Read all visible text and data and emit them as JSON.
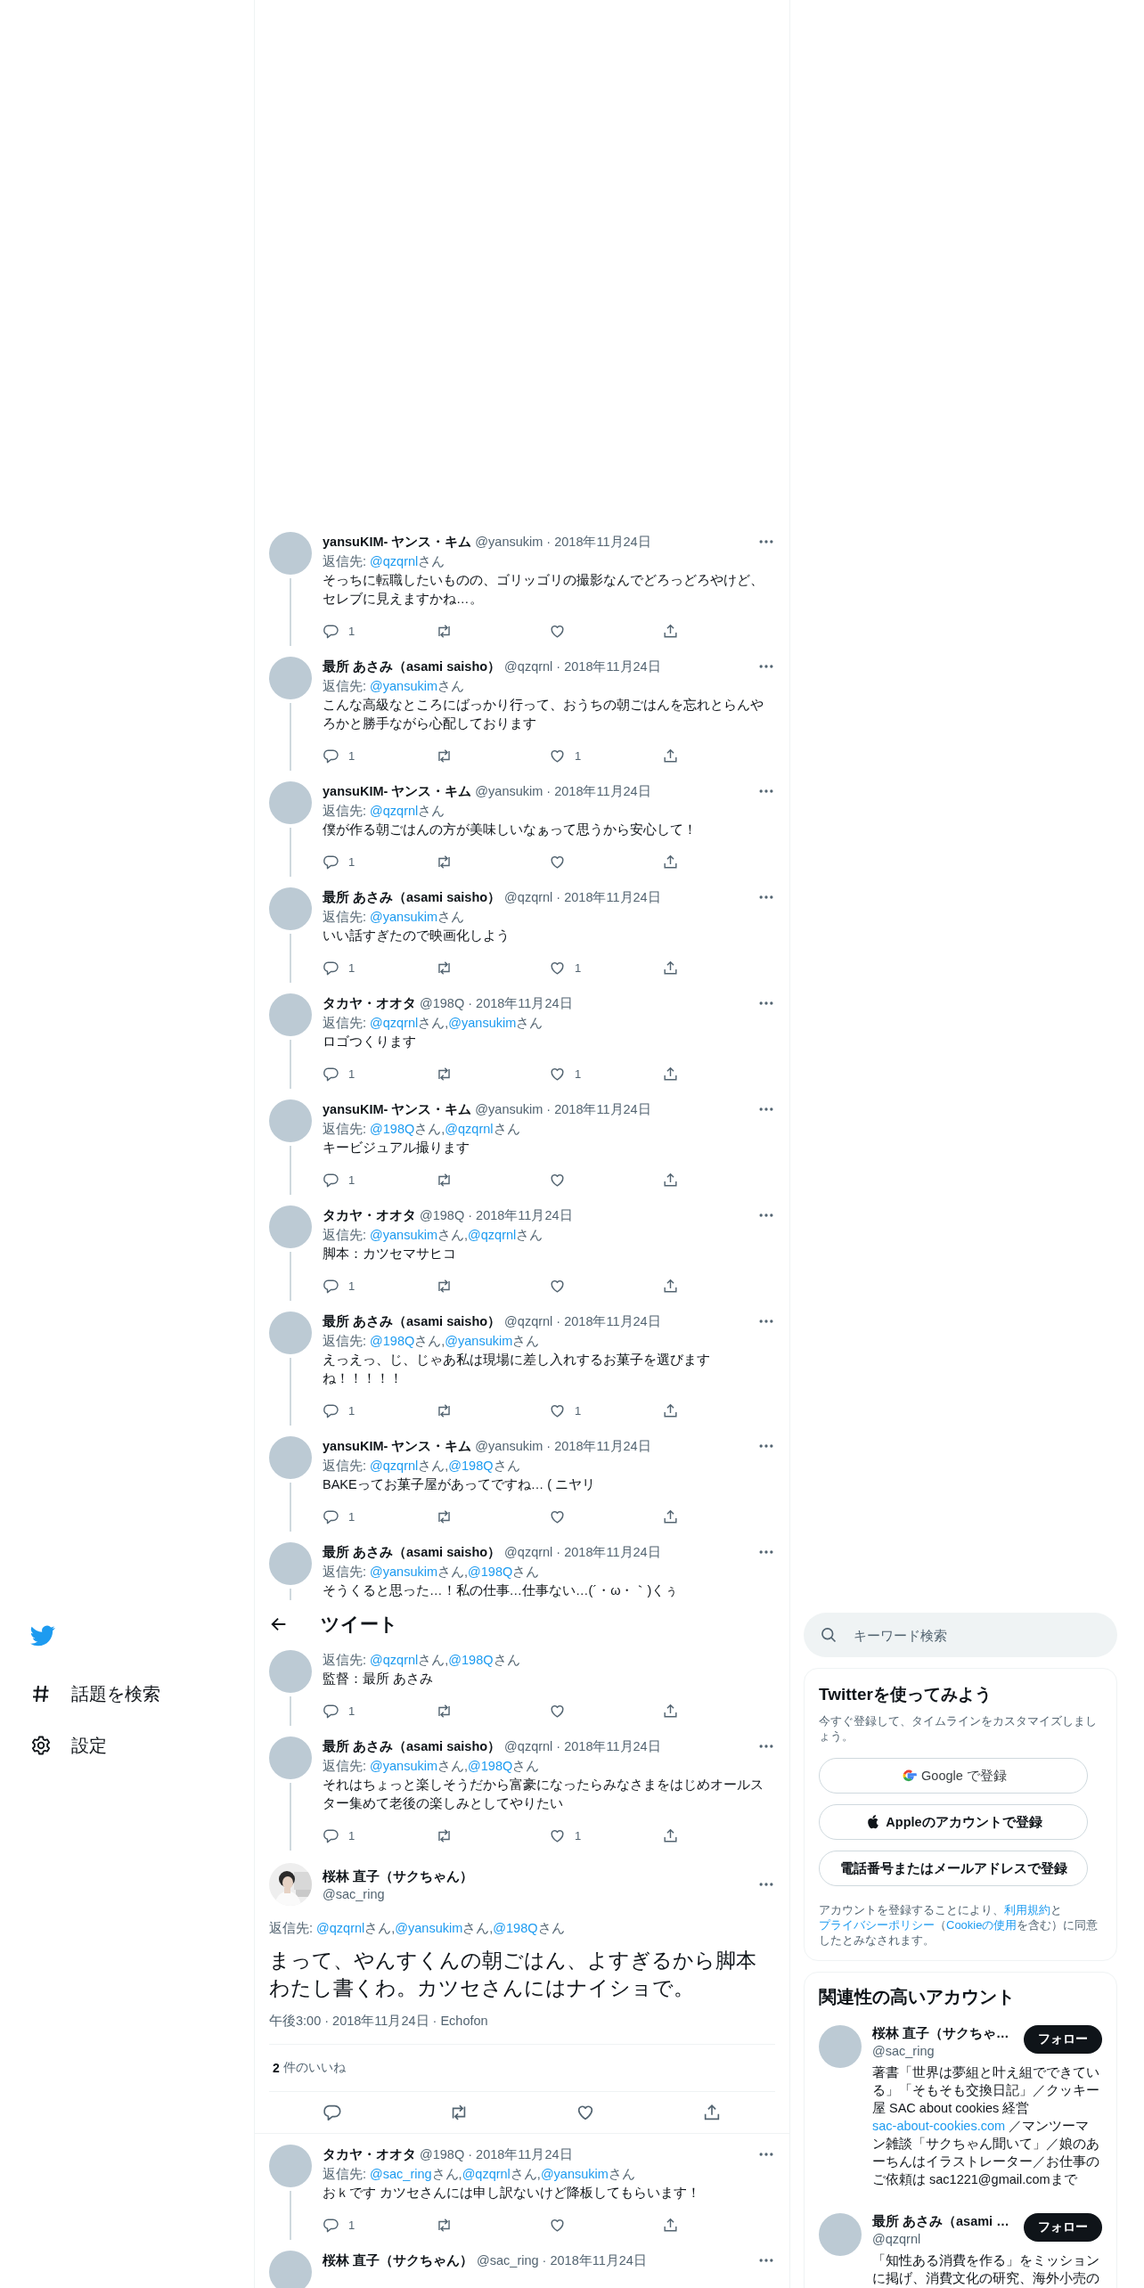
{
  "nav": {
    "items": [
      {
        "kind": "hash",
        "label": "話題を検索"
      },
      {
        "kind": "gear",
        "label": "設定"
      }
    ]
  },
  "timeline": [
    {
      "kind": "reply",
      "name": "yansuKIM- ヤンス・キム",
      "meta": "@yansukim · 2018年11月24日",
      "reply_label": "返信先:",
      "mentions": [
        {
          "handle": "@qzqrnl",
          "suffix": "さん"
        }
      ],
      "text": "そっちに転職したいものの、ゴリッゴリの撮影なんでどろっどろやけど、セレブに見えますかね…。",
      "replies": "1"
    },
    {
      "kind": "reply",
      "name": "最所 あさみ（asami saisho）",
      "meta": "@qzqrnl · 2018年11月24日",
      "reply_label": "返信先:",
      "mentions": [
        {
          "handle": "@yansukim",
          "suffix": "さん"
        }
      ],
      "text": "こんな高級なところにばっかり行って、おうちの朝ごはんを忘れとらんやろかと勝手ながら心配しております",
      "replies": "1",
      "likes": "1"
    },
    {
      "kind": "reply",
      "name": "yansuKIM- ヤンス・キム",
      "meta": "@yansukim · 2018年11月24日",
      "reply_label": "返信先:",
      "mentions": [
        {
          "handle": "@qzqrnl",
          "suffix": "さん"
        }
      ],
      "text": "僕が作る朝ごはんの方が美味しいなぁって思うから安心して！",
      "replies": "1"
    },
    {
      "kind": "reply",
      "name": "最所 あさみ（asami saisho）",
      "meta": "@qzqrnl · 2018年11月24日",
      "reply_label": "返信先:",
      "mentions": [
        {
          "handle": "@yansukim",
          "suffix": "さん"
        }
      ],
      "text": "いい話すぎたので映画化しよう",
      "replies": "1",
      "likes": "1"
    },
    {
      "kind": "reply",
      "name": "タカヤ・オオタ",
      "meta": "@198Q · 2018年11月24日",
      "reply_label": "返信先:",
      "mentions": [
        {
          "handle": "@qzqrnl",
          "suffix": "さん,"
        },
        {
          "handle": "@yansukim",
          "suffix": "さん"
        }
      ],
      "text": "ロゴつくります",
      "replies": "1",
      "likes": "1"
    },
    {
      "kind": "reply",
      "name": "yansuKIM- ヤンス・キム",
      "meta": "@yansukim · 2018年11月24日",
      "reply_label": "返信先:",
      "mentions": [
        {
          "handle": "@198Q",
          "suffix": "さん,"
        },
        {
          "handle": "@qzqrnl",
          "suffix": "さん"
        }
      ],
      "text": "キービジュアル撮ります",
      "replies": "1"
    },
    {
      "kind": "reply",
      "name": "タカヤ・オオタ",
      "meta": "@198Q · 2018年11月24日",
      "reply_label": "返信先:",
      "mentions": [
        {
          "handle": "@yansukim",
          "suffix": "さん,"
        },
        {
          "handle": "@qzqrnl",
          "suffix": "さん"
        }
      ],
      "text": "脚本：カツセマサヒコ",
      "replies": "1"
    },
    {
      "kind": "reply",
      "name": "最所 あさみ（asami saisho）",
      "meta": "@qzqrnl · 2018年11月24日",
      "reply_label": "返信先:",
      "mentions": [
        {
          "handle": "@198Q",
          "suffix": "さん,"
        },
        {
          "handle": "@yansukim",
          "suffix": "さん"
        }
      ],
      "text": "えっえっ、じ、じゃあ私は現場に差し入れするお菓子を選びますね！！！！！",
      "replies": "1",
      "likes": "1"
    },
    {
      "kind": "reply",
      "name": "yansuKIM- ヤンス・キム",
      "meta": "@yansukim · 2018年11月24日",
      "reply_label": "返信先:",
      "mentions": [
        {
          "handle": "@qzqrnl",
          "suffix": "さん,"
        },
        {
          "handle": "@198Q",
          "suffix": "さん"
        }
      ],
      "text": "BAKEってお菓子屋があってですね… ( ニヤリ",
      "replies": "1"
    },
    {
      "kind": "reply",
      "name": "最所 あさみ（asami saisho）",
      "meta": "@qzqrnl · 2018年11月24日",
      "reply_label": "返信先:",
      "mentions": [
        {
          "handle": "@yansukim",
          "suffix": "さん,"
        },
        {
          "handle": "@198Q",
          "suffix": "さん"
        }
      ],
      "text": "そうくると思った…！私の仕事…仕事ない…(´・ω・｀)くぅ",
      "hide_actions": true
    },
    {
      "kind": "header",
      "title": "ツイート"
    },
    {
      "kind": "reply",
      "reply_label": "返信先:",
      "mentions": [
        {
          "handle": "@qzqrnl",
          "suffix": "さん,"
        },
        {
          "handle": "@198Q",
          "suffix": "さん"
        }
      ],
      "text": "監督：最所 あさみ",
      "replies": "1"
    },
    {
      "kind": "reply",
      "name": "最所 あさみ（asami saisho）",
      "meta": "@qzqrnl · 2018年11月24日",
      "reply_label": "返信先:",
      "mentions": [
        {
          "handle": "@yansukim",
          "suffix": "さん,"
        },
        {
          "handle": "@198Q",
          "suffix": "さん"
        }
      ],
      "text": "それはちょっと楽しそうだから富豪になったらみなさまをはじめオールスター集めて老後の楽しみとしてやりたい",
      "replies": "1",
      "likes": "1"
    },
    {
      "kind": "focus",
      "name": "桜林 直子（サクちゃん）",
      "handle": "@sac_ring",
      "reply_label": "返信先:",
      "mentions": [
        {
          "handle": "@qzqrnl",
          "suffix": "さん,"
        },
        {
          "handle": "@yansukim",
          "suffix": "さん,"
        },
        {
          "handle": "@198Q",
          "suffix": "さん"
        }
      ],
      "text": "まって、やんすくんの朝ごはん、よすぎるから脚本わたし書くわ。カツセさんにはナイショで。",
      "meta": "午後3:00 · 2018年11月24日 · Echofon",
      "like_count": "2",
      "like_label": "件のいいね"
    },
    {
      "kind": "reply",
      "name": "タカヤ・オオタ",
      "meta": "@198Q · 2018年11月24日",
      "reply_label": "返信先:",
      "mentions": [
        {
          "handle": "@sac_ring",
          "suffix": "さん,"
        },
        {
          "handle": "@qzqrnl",
          "suffix": "さん,"
        },
        {
          "handle": "@yansukim",
          "suffix": "さん"
        }
      ],
      "text": "おｋです カツセさんには申し訳ないけど降板してもらいます！",
      "replies": "1"
    },
    {
      "kind": "reply",
      "name": "桜林 直子（サクちゃん）",
      "meta": "@sac_ring · 2018年11月24日",
      "hide_actions": true
    }
  ],
  "search": {
    "placeholder": "キーワード検索"
  },
  "signup": {
    "title": "Twitterを使ってみよう",
    "subtitle": "今すぐ登録して、タイムラインをカスタマイズしましょう。",
    "buttons": [
      {
        "kind": "google",
        "label": "Google で登録"
      },
      {
        "kind": "apple",
        "label": "Appleのアカウントで登録"
      },
      {
        "kind": "phone",
        "label": "電話番号またはメールアドレスで登録"
      }
    ],
    "legal": [
      {
        "text": "アカウントを登録することにより、",
        "link": false
      },
      {
        "text": "利用規約",
        "link": true
      },
      {
        "text": "と",
        "link": false
      },
      {
        "text": "プライバシーポリシー",
        "link": true
      },
      {
        "text": "（",
        "link": false
      },
      {
        "text": "Cookieの使用",
        "link": true
      },
      {
        "text": "を含む）に同意したとみなされます。",
        "link": false
      }
    ]
  },
  "related": {
    "title": "関連性の高いアカウント",
    "accounts": [
      {
        "name": "桜林 直子（サクちゃ…",
        "handle": "@sac_ring",
        "button": "フォロー",
        "bio": [
          {
            "text": "著書「世界は夢組と叶え組でできている」「そもそも交換日記」／クッキー屋 SAC about cookies 経営 ",
            "link": false
          },
          {
            "text": "sac-about-cookies.com",
            "link": true
          },
          {
            "text": " ／マンツーマン雑談「サクちゃん聞いて」／娘のあーちんはイラストレーター／お仕事のご依頼は sac1221@gmail.comまで",
            "link": false
          }
        ]
      },
      {
        "name": "最所 あさみ（asami …",
        "handle": "@qzqrnl",
        "button": "フォロー",
        "bio": [
          {
            "text": "「知性ある消費を作る」をミッションに掲げ、消費文化の研究、海外小売の",
            "link": false
          }
        ]
      }
    ]
  }
}
